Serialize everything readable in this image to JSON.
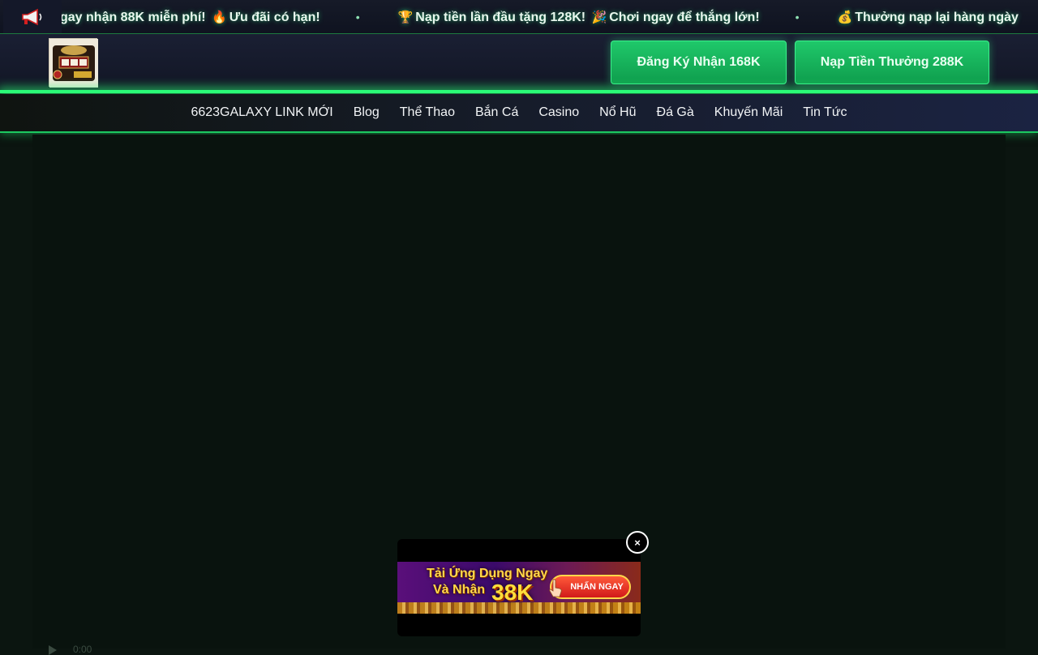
{
  "ticker": {
    "icon": "megaphone-icon",
    "messages": [
      {
        "text": "gay nhận 88K miễn phí!",
        "emoji": "🔥",
        "text2": "Ưu đãi có hạn!"
      },
      {
        "emoji": "🏆",
        "text": "Nạp tiền lần đầu tặng 128K!",
        "emoji2": "🎉",
        "text2": "Chơi ngay để thắng lớn!"
      },
      {
        "emoji": "💰",
        "text": "Thưởng nạp lại hàng ngày"
      }
    ],
    "separator": "•"
  },
  "header": {
    "logo_name": "casino-logo",
    "cta_register": "Đăng Ký Nhận 168K",
    "cta_deposit": "Nạp Tiền Thưởng 288K"
  },
  "nav": {
    "items": [
      "6623GALAXY LINK MỚI",
      "Blog",
      "Thể Thao",
      "Bắn Cá",
      "Casino",
      "Nổ Hũ",
      "Đá Gà",
      "Khuyến Mãi",
      "Tin Tức"
    ]
  },
  "popup": {
    "line1": "Tải Ứng Dụng Ngay",
    "line2": "Và Nhận",
    "amount": "38K",
    "button": "NHẤN NGAY",
    "close": "×"
  },
  "video": {
    "time": "0:00"
  },
  "colors": {
    "accent": "#2dff7a",
    "cta": "#1fc86a",
    "background": "#0b1510"
  }
}
